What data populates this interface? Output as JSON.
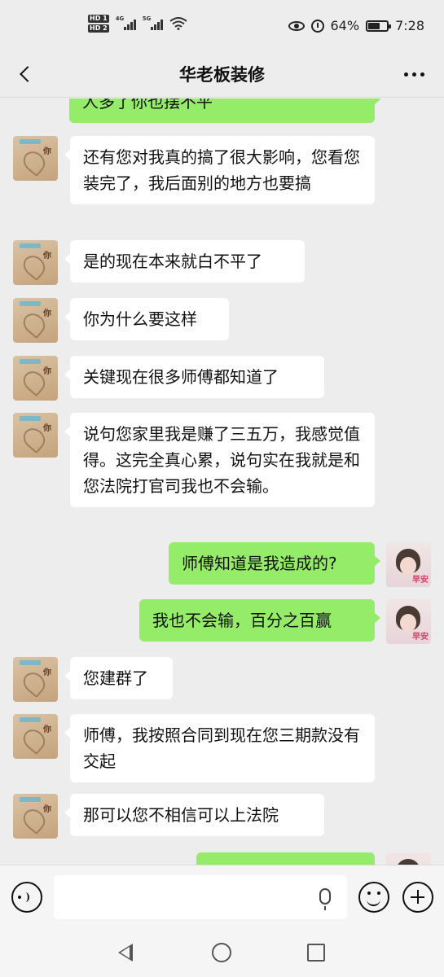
{
  "status_bar": {
    "network_left": "4G",
    "network_right": "5G",
    "battery": "64%",
    "time": "7:28",
    "battery_level": 0.64,
    "icons": [
      "hd-icon",
      "signal-icon",
      "wifi-icon",
      "eye-icon",
      "alarm-icon",
      "battery-icon"
    ]
  },
  "header": {
    "title": "华老板装修",
    "icons": [
      "back-icon",
      "more-icon"
    ]
  },
  "messages": [
    {
      "side": "right",
      "text": "人多了你也摆不平"
    },
    {
      "side": "left",
      "text": "还有您对我真的搞了很大影响，您看您装完了，我后面别的地方也要搞"
    },
    {
      "side": "left",
      "text": "是的现在本来就白不平了"
    },
    {
      "side": "left",
      "text": "你为什么要这样"
    },
    {
      "side": "left",
      "text": "关键现在很多师傅都知道了"
    },
    {
      "side": "left",
      "text": "说句您家里我是赚了三五万，我感觉值得。这完全真心累，说句实在我就是和您法院打官司我也不会输。"
    },
    {
      "side": "right",
      "text": "师傅知道是我造成的?"
    },
    {
      "side": "right",
      "text": "我也不会输，百分之百赢"
    },
    {
      "side": "left",
      "text": "您建群了"
    },
    {
      "side": "left",
      "text": "师傅，我按照合同到现在您三期款没有交起"
    },
    {
      "side": "left",
      "text": "那可以您不相信可以上法院"
    }
  ],
  "avatars": {
    "contact_text": "你",
    "me_text": "早安"
  },
  "input_bar": {
    "placeholder": "",
    "icons": [
      "voice-icon",
      "mic-icon",
      "emoji-icon",
      "plus-icon"
    ]
  },
  "nav_bar": {
    "icons": [
      "nav-back-icon",
      "nav-home-icon",
      "nav-recent-icon"
    ]
  }
}
